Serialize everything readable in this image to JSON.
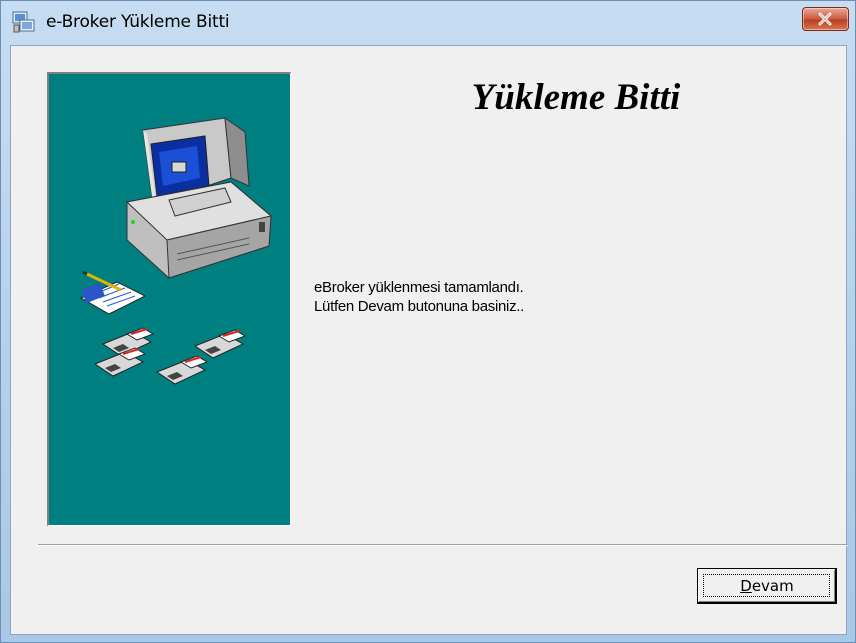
{
  "window": {
    "title": "e-Broker Yükleme Bitti",
    "title_icon": "setup-icon",
    "close_icon": "close-icon"
  },
  "content": {
    "heading": "Yükleme Bitti",
    "message_line1": "eBroker yüklenmesi tamamlandı.",
    "message_line2": "Lütfen Devam butonuna basiniz.."
  },
  "buttons": {
    "continue_label_accel": "D",
    "continue_label_rest": "evam"
  },
  "colors": {
    "banner": "#007f80",
    "dialog_bg": "#f0f0f0",
    "frame": "#a9c7e6"
  }
}
